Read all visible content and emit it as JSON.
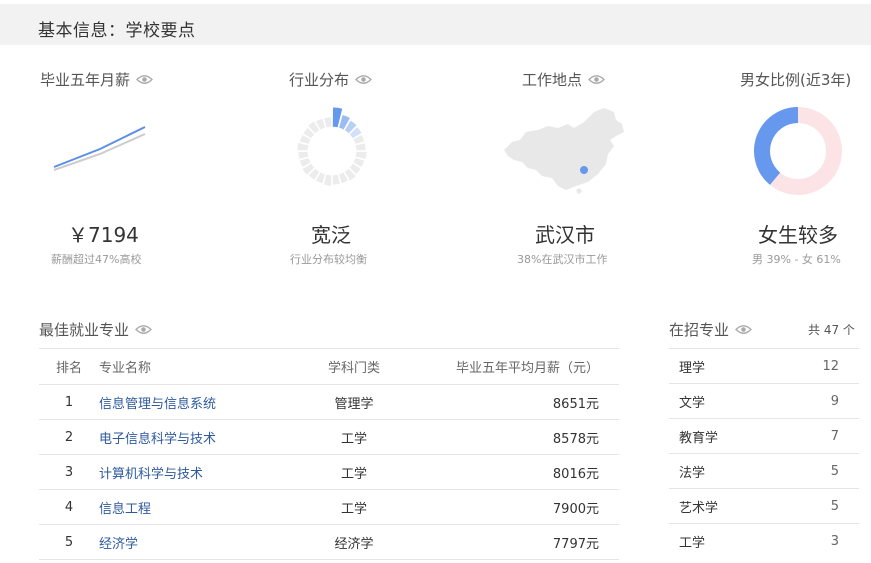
{
  "header": {
    "title": "基本信息：学校要点"
  },
  "stats": {
    "salary": {
      "title": "毕业五年月薪",
      "value": "￥7194",
      "note": "薪酬超过47%高校"
    },
    "industry": {
      "title": "行业分布",
      "value": "宽泛",
      "note": "行业分布较均衡"
    },
    "location": {
      "title": "工作地点",
      "value": "武汉市",
      "note": "38%在武汉市工作"
    },
    "gender": {
      "title": "男女比例(近3年)",
      "value": "女生较多",
      "note": "男 39% - 女 61%",
      "male_pct": 39,
      "female_pct": 61
    }
  },
  "colors": {
    "accent": "#6699ee",
    "female": "#fce4e6",
    "map": "#e8e8e8"
  },
  "majors": {
    "title": "最佳就业专业",
    "headers": [
      "排名",
      "专业名称",
      "学科门类",
      "毕业五年平均月薪（元）"
    ],
    "rows": [
      {
        "rank": "1",
        "name": "信息管理与信息系统",
        "category": "管理学",
        "salary": "8651元"
      },
      {
        "rank": "2",
        "name": "电子信息科学与技术",
        "category": "工学",
        "salary": "8578元"
      },
      {
        "rank": "3",
        "name": "计算机科学与技术",
        "category": "工学",
        "salary": "8016元"
      },
      {
        "rank": "4",
        "name": "信息工程",
        "category": "工学",
        "salary": "7900元"
      },
      {
        "rank": "5",
        "name": "经济学",
        "category": "经济学",
        "salary": "7797元"
      }
    ]
  },
  "enrollment": {
    "title": "在招专业",
    "count": "共 47 个",
    "rows": [
      {
        "name": "理学",
        "count": "12"
      },
      {
        "name": "文学",
        "count": "9"
      },
      {
        "name": "教育学",
        "count": "7"
      },
      {
        "name": "法学",
        "count": "5"
      },
      {
        "name": "艺术学",
        "count": "5"
      },
      {
        "name": "工学",
        "count": "3"
      }
    ]
  }
}
